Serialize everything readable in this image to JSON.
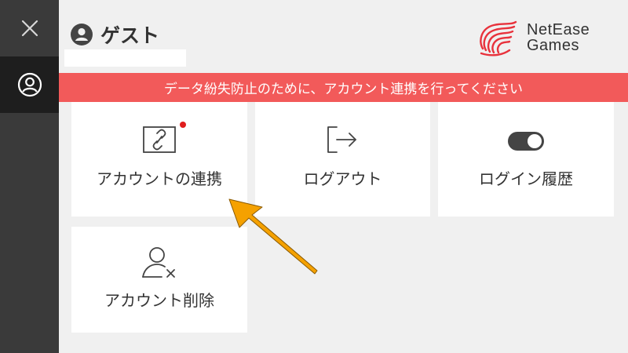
{
  "user": {
    "name": "ゲスト"
  },
  "brand": {
    "line1": "NetEase",
    "line2": "Games",
    "color": "#e8323c"
  },
  "banner": {
    "text": "データ紛失防止のために、アカウント連携を行ってください",
    "color": "#f25a5a"
  },
  "cards": [
    {
      "label": "アカウントの連携",
      "icon": "link-icon",
      "badge": true
    },
    {
      "label": "ログアウト",
      "icon": "logout-icon",
      "badge": false
    },
    {
      "label": "ログイン履歴",
      "icon": "toggle-icon",
      "badge": false
    },
    {
      "label": "アカウント削除",
      "icon": "user-remove-icon",
      "badge": false
    }
  ],
  "sidebar": {
    "items": [
      {
        "icon": "close-icon"
      },
      {
        "icon": "profile-icon"
      }
    ]
  },
  "annotation": {
    "color": "#f5a100"
  }
}
